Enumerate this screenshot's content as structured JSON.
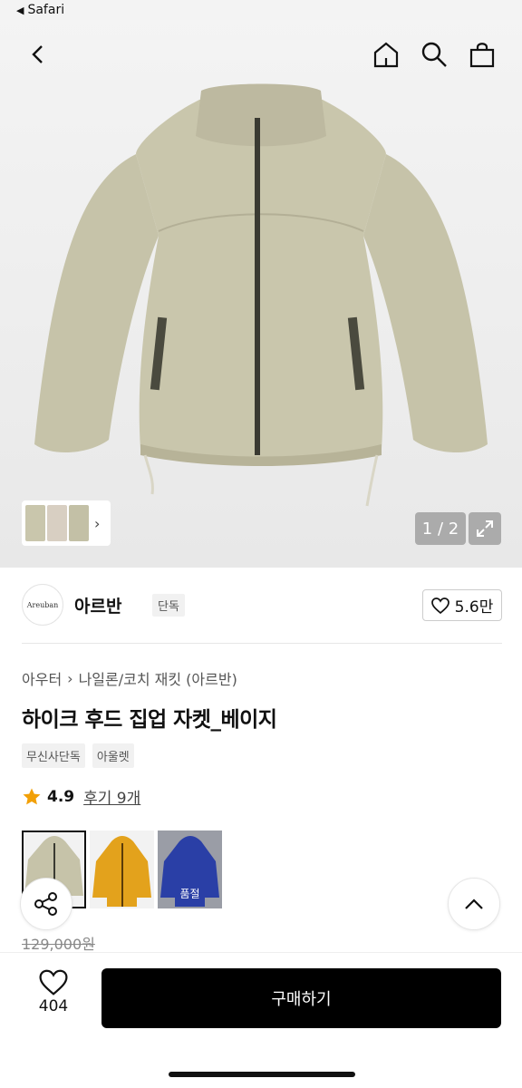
{
  "status_bar": {
    "back_app": "Safari"
  },
  "hero": {
    "counter": "1 / 2",
    "icons": [
      "back-icon",
      "home-icon",
      "search-icon",
      "bag-icon",
      "expand-icon"
    ],
    "jacket_color": "#c6c3a9"
  },
  "brand": {
    "logo_text": "Areuban",
    "name": "아르반",
    "badge": "단독",
    "likes": "5.6만"
  },
  "breadcrumb": [
    "아우터",
    "나일론/코치 재킷 (아르반)"
  ],
  "product": {
    "title": "하이크 후드 집업 자켓_베이지",
    "tags": [
      "무신사단독",
      "아울렛"
    ],
    "rating": "4.9",
    "reviews": "후기 9개",
    "original_price": "129,000원"
  },
  "color_options": [
    {
      "name": "베이지",
      "color": "#c6c3a9",
      "selected": true
    },
    {
      "name": "옐로우",
      "color": "#e3a21c",
      "selected": false
    },
    {
      "name": "블루",
      "color": "#2a3fa6",
      "selected": false,
      "label": "품절"
    }
  ],
  "bottom_bar": {
    "wish_count": "404",
    "buy_label": "구매하기"
  }
}
